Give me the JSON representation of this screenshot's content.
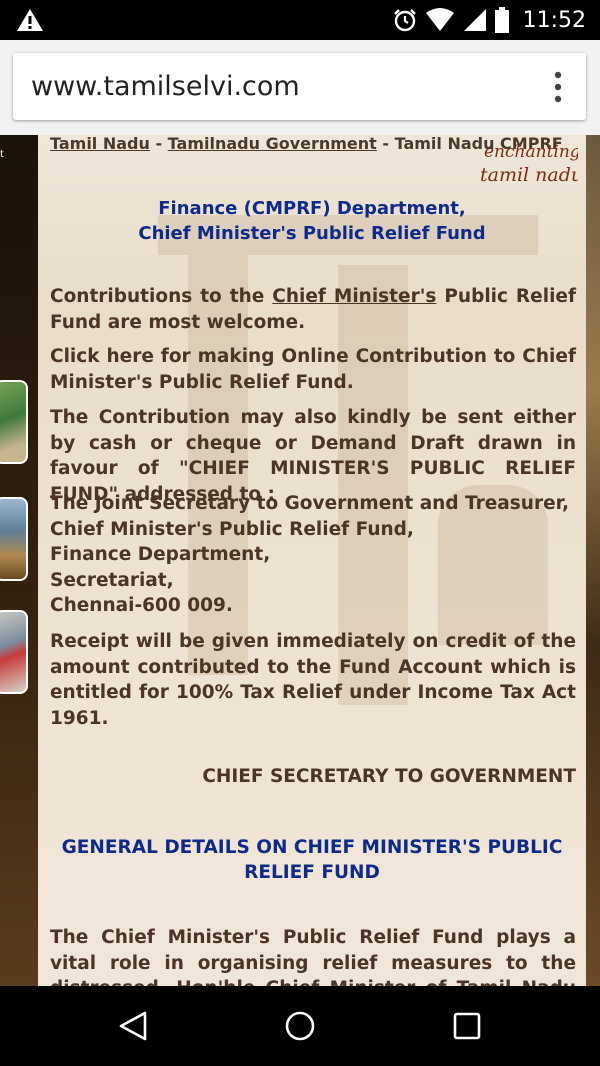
{
  "status_bar": {
    "time": "11:52",
    "icons": [
      "warning-icon",
      "alarm-icon",
      "wifi-icon",
      "signal-icon",
      "battery-icon"
    ]
  },
  "browser": {
    "url": "www.tamilselvi.com",
    "menu_icon": "overflow-menu-icon"
  },
  "page": {
    "breadcrumb": {
      "item1": "Tamil Nadu",
      "sep1": " - ",
      "item2": "Tamilnadu Government",
      "sep2": " - ",
      "item3": "Tamil Nadu CMPRF"
    },
    "logo": {
      "line1": "enchanting",
      "line2": "tamil nadu"
    },
    "left_strip_text": "t",
    "dept_title_line1": "Finance (CMPRF) Department,",
    "dept_title_line2": "Chief Minister's Public Relief Fund",
    "p1_before": "Contributions to the ",
    "p1_link": "Chief Minister's",
    "p1_after": " Public Relief Fund are most welcome.",
    "p2": "Click here for making Online Contribution to Chief Minister's Public Relief Fund.",
    "p3": "The Contribution may also kindly be sent either by cash or cheque or Demand Draft drawn in favour of  \"CHIEF MINISTER'S PUBLIC RELIEF FUND\" addressed to :",
    "address": [
      "The Joint Secretary to Government and Treasurer,",
      "Chief Minister's Public Relief Fund,",
      "Finance Department,",
      "Secretariat,",
      "Chennai-600 009."
    ],
    "p4": "Receipt will be given immediately on credit of the amount contributed to the Fund Account which is entitled for 100% Tax Relief under Income Tax Act 1961.",
    "signature": "CHIEF  SECRETARY TO GOVERNMENT",
    "general_title_line1": "GENERAL DETAILS ON CHIEF MINISTER'S PUBLIC",
    "general_title_line2": "RELIEF FUND",
    "p5": "The Chief Minister's Public Relief Fund plays a vital role in organising relief measures to the distressed. Hon'ble Chief Minister of Tamil Nadu sanctions financial"
  },
  "nav_bar": {
    "icons": [
      "back-icon",
      "home-icon",
      "recents-icon"
    ]
  },
  "colors": {
    "heading_blue": "#0d2b8a",
    "body_brown": "#4a3526",
    "page_bg": "#efe6d8"
  }
}
